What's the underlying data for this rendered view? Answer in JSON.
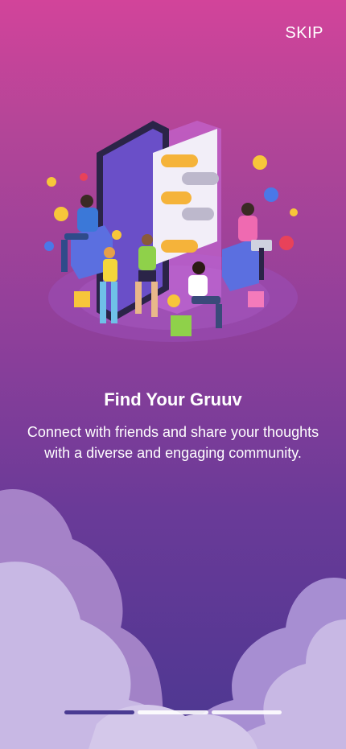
{
  "header": {
    "skip_label": "SKIP"
  },
  "onboarding": {
    "title": "Find Your Gruuv",
    "description": "Connect with friends and share your thoughts with a diverse and engaging community.",
    "illustration_icon": "social-community-illustration",
    "current_page": 1,
    "total_pages": 3
  },
  "colors": {
    "gradient_top": "#d2449a",
    "gradient_bottom": "#4b3791",
    "text": "#ffffff",
    "pager_active": "#4a3b92",
    "pager_inactive": "#ffffff"
  }
}
